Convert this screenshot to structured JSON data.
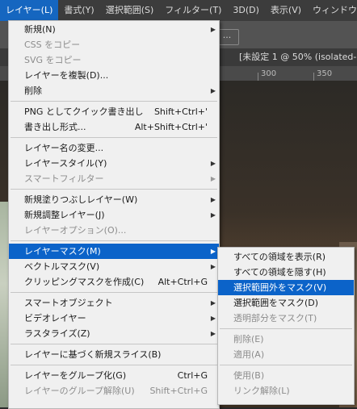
{
  "menubar": [
    {
      "label": "レイヤー(L)",
      "active": true
    },
    {
      "label": "書式(Y)"
    },
    {
      "label": "選択範囲(S)"
    },
    {
      "label": "フィルター(T)"
    },
    {
      "label": "3D(D)"
    },
    {
      "label": "表示(V)"
    },
    {
      "label": "ウィンドウ"
    }
  ],
  "options_bar": {
    "box_label": "..."
  },
  "document": {
    "tab_title": "[未設定 1 @ 50% (isolated-144",
    "ruler_numbers": [
      "300",
      "350"
    ]
  },
  "layer_menu": {
    "groups": [
      [
        {
          "label": "新規(N)",
          "submenu": true
        },
        {
          "label": "CSS をコピー",
          "disabled": true
        },
        {
          "label": "SVG をコピー",
          "disabled": true
        },
        {
          "label": "レイヤーを複製(D)..."
        },
        {
          "label": "削除",
          "submenu": true
        }
      ],
      [
        {
          "label": "PNG としてクイック書き出し",
          "shortcut": "Shift+Ctrl+'"
        },
        {
          "label": "書き出し形式...",
          "shortcut": "Alt+Shift+Ctrl+'"
        }
      ],
      [
        {
          "label": "レイヤー名の変更..."
        },
        {
          "label": "レイヤースタイル(Y)",
          "submenu": true
        },
        {
          "label": "スマートフィルター",
          "submenu": true,
          "disabled": true
        }
      ],
      [
        {
          "label": "新規塗りつぶしレイヤー(W)",
          "submenu": true
        },
        {
          "label": "新規調整レイヤー(J)",
          "submenu": true
        },
        {
          "label": "レイヤーオプション(O)...",
          "disabled": true
        }
      ],
      [
        {
          "label": "レイヤーマスク(M)",
          "submenu": true,
          "highlighted": true
        },
        {
          "label": "ベクトルマスク(V)",
          "submenu": true
        },
        {
          "label": "クリッピングマスクを作成(C)",
          "shortcut": "Alt+Ctrl+G"
        }
      ],
      [
        {
          "label": "スマートオブジェクト",
          "submenu": true
        },
        {
          "label": "ビデオレイヤー",
          "submenu": true
        },
        {
          "label": "ラスタライズ(Z)",
          "submenu": true
        }
      ],
      [
        {
          "label": "レイヤーに基づく新規スライス(B)"
        }
      ],
      [
        {
          "label": "レイヤーをグループ化(G)",
          "shortcut": "Ctrl+G"
        },
        {
          "label": "レイヤーのグループ解除(U)",
          "shortcut": "Shift+Ctrl+G",
          "disabled": true
        }
      ]
    ]
  },
  "mask_submenu": {
    "groups": [
      [
        {
          "label": "すべての領域を表示(R)"
        },
        {
          "label": "すべての領域を隠す(H)"
        },
        {
          "label": "選択範囲外をマスク(V)",
          "highlighted": true
        },
        {
          "label": "選択範囲をマスク(D)"
        },
        {
          "label": "透明部分をマスク(T)",
          "disabled": true
        }
      ],
      [
        {
          "label": "削除(E)",
          "disabled": true
        },
        {
          "label": "適用(A)",
          "disabled": true
        }
      ],
      [
        {
          "label": "使用(B)",
          "disabled": true
        },
        {
          "label": "リンク解除(L)",
          "disabled": true
        }
      ]
    ]
  },
  "colors": {
    "highlight": "#0b63c9",
    "menu_bg": "#f0f0f0",
    "menubar_bg": "#3c3c3c",
    "disabled_text": "#8c8c8c"
  },
  "icons": {
    "submenu_arrow": "right-triangle-icon"
  }
}
